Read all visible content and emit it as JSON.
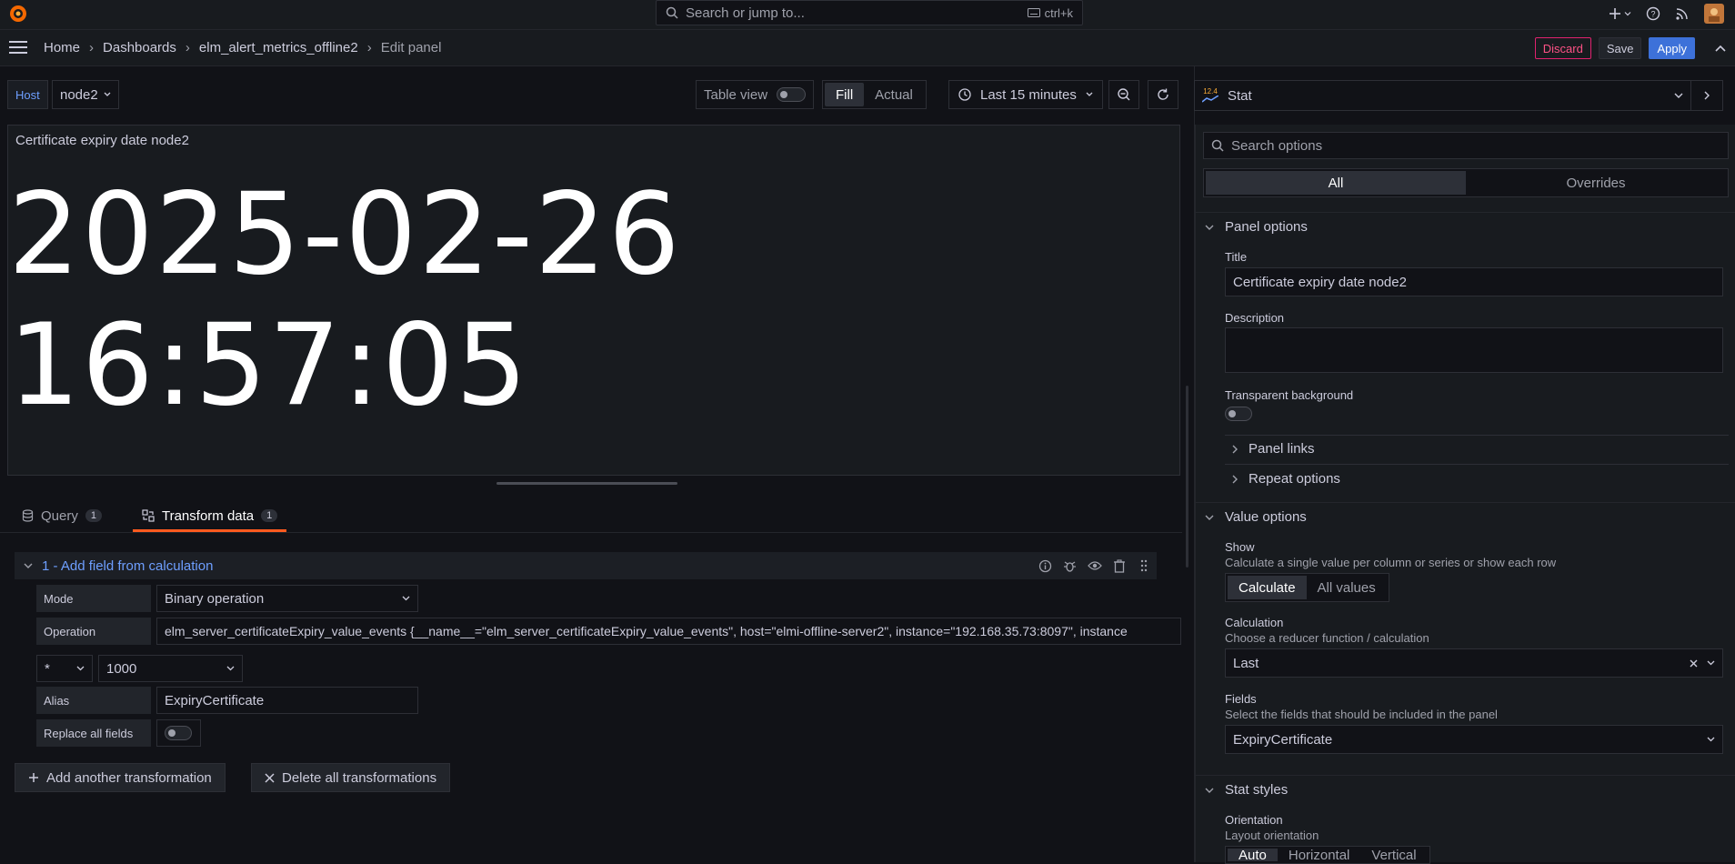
{
  "search": {
    "placeholder": "Search or jump to...",
    "shortcut": "ctrl+k"
  },
  "breadcrumb": {
    "home": "Home",
    "dashboards": "Dashboards",
    "dashboard": "elm_alert_metrics_offline2",
    "current": "Edit panel"
  },
  "nav_actions": {
    "discard": "Discard",
    "save": "Save",
    "apply": "Apply"
  },
  "toolbar": {
    "host_label": "Host",
    "host_value": "node2",
    "table_view": "Table view",
    "fill": "Fill",
    "actual": "Actual",
    "time_range": "Last 15 minutes"
  },
  "panel": {
    "title": "Certificate expiry date node2",
    "value": "2025-02-26 16:57:05"
  },
  "tabs": [
    {
      "label": "Query",
      "count": "1"
    },
    {
      "label": "Transform data",
      "count": "1"
    }
  ],
  "transform": {
    "title": "1 - Add field from calculation",
    "mode_label": "Mode",
    "mode_value": "Binary operation",
    "operation_label": "Operation",
    "operation_value": "elm_server_certificateExpiry_value_events {__name__=\"elm_server_certificateExpiry_value_events\", host=\"elmi-offline-server2\", instance=\"192.168.35.73:8097\", instance",
    "operator": "*",
    "operand": "1000",
    "alias_label": "Alias",
    "alias_value": "ExpiryCertificate",
    "replace_label": "Replace all fields",
    "add_button": "Add another transformation",
    "delete_button": "Delete all transformations"
  },
  "options": {
    "viz": "Stat",
    "viz_icon_text": "12.4",
    "search_placeholder": "Search options",
    "tab_all": "All",
    "tab_overrides": "Overrides",
    "panel_options": {
      "heading": "Panel options",
      "title_label": "Title",
      "title_value": "Certificate expiry date node2",
      "description_label": "Description",
      "transparent_label": "Transparent background",
      "panel_links": "Panel links",
      "repeat_options": "Repeat options"
    },
    "value_options": {
      "heading": "Value options",
      "show_label": "Show",
      "show_desc": "Calculate a single value per column or series or show each row",
      "show_calculate": "Calculate",
      "show_all_values": "All values",
      "calc_label": "Calculation",
      "calc_desc": "Choose a reducer function / calculation",
      "calc_value": "Last",
      "fields_label": "Fields",
      "fields_desc": "Select the fields that should be included in the panel",
      "fields_value": "ExpiryCertificate"
    },
    "stat_styles": {
      "heading": "Stat styles",
      "orientation_label": "Orientation",
      "orientation_desc": "Layout orientation",
      "auto": "Auto",
      "horizontal": "Horizontal",
      "vertical": "Vertical"
    }
  }
}
